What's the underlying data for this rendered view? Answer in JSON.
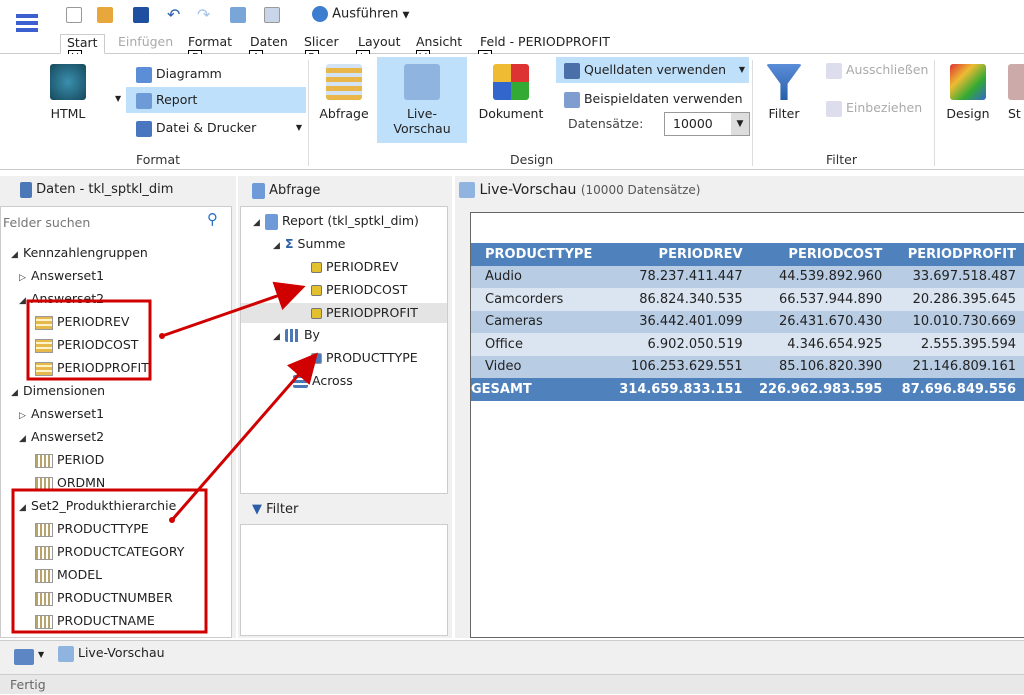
{
  "toolbar": {
    "run_label": "Ausführen"
  },
  "tabs": [
    {
      "label": "Start",
      "key": "H"
    },
    {
      "label": "Einfügen",
      "key": ""
    },
    {
      "label": "Format",
      "key": "F"
    },
    {
      "label": "Daten",
      "key": "A"
    },
    {
      "label": "Slicer",
      "key": "R"
    },
    {
      "label": "Layout",
      "key": "L"
    },
    {
      "label": "Ansicht",
      "key": "V"
    },
    {
      "label": "Feld - PERIODPROFIT",
      "key": "C"
    }
  ],
  "ribbon": {
    "format": {
      "group": "Format",
      "html": "HTML",
      "diagramm": "Diagramm",
      "report": "Report",
      "datei": "Datei & Drucker"
    },
    "design": {
      "group": "Design",
      "abfrage": "Abfrage",
      "live1": "Live-",
      "live2": "Vorschau",
      "dokument": "Dokument",
      "quelldaten": "Quelldaten verwenden",
      "beispiel": "Beispieldaten verwenden",
      "datensaetze_label": "Datensätze:",
      "datensaetze_value": "10000"
    },
    "filter": {
      "group": "Filter",
      "filter": "Filter",
      "ausschliessen": "Ausschließen",
      "einbeziehen": "Einbeziehen"
    },
    "other": {
      "design": "Design",
      "st": "St"
    }
  },
  "left": {
    "title": "Daten - tkl_sptkl_dim",
    "search_placeholder": "Felder suchen",
    "tree": [
      {
        "label": "Kennzahlengruppen",
        "lvl": 0,
        "tri": "◢"
      },
      {
        "label": "Answerset1",
        "lvl": 1,
        "tri": "▷"
      },
      {
        "label": "Answerset2",
        "lvl": 1,
        "tri": "◢"
      },
      {
        "label": "PERIODREV",
        "lvl": 2,
        "icon": "measure"
      },
      {
        "label": "PERIODCOST",
        "lvl": 2,
        "icon": "measure"
      },
      {
        "label": "PERIODPROFIT",
        "lvl": 2,
        "icon": "measure"
      },
      {
        "label": "Dimensionen",
        "lvl": 0,
        "tri": "◢"
      },
      {
        "label": "Answerset1",
        "lvl": 1,
        "tri": "▷"
      },
      {
        "label": "Answerset2",
        "lvl": 1,
        "tri": "◢"
      },
      {
        "label": "PERIOD",
        "lvl": 2,
        "icon": "dim"
      },
      {
        "label": "ORDMN",
        "lvl": 2,
        "icon": "dim"
      },
      {
        "label": "Set2_Produkthierarchie",
        "lvl": 1,
        "tri": "◢"
      },
      {
        "label": "PRODUCTTYPE",
        "lvl": 2,
        "icon": "dim"
      },
      {
        "label": "PRODUCTCATEGORY",
        "lvl": 2,
        "icon": "dim"
      },
      {
        "label": "MODEL",
        "lvl": 2,
        "icon": "dim"
      },
      {
        "label": "PRODUCTNUMBER",
        "lvl": 2,
        "icon": "dim"
      },
      {
        "label": "PRODUCTNAME",
        "lvl": 2,
        "icon": "dim"
      }
    ]
  },
  "middle": {
    "title": "Abfrage",
    "report": "Report (tkl_sptkl_dim)",
    "summe": "Summe",
    "sum_items": [
      "PERIODREV",
      "PERIODCOST",
      "PERIODPROFIT"
    ],
    "by": "By",
    "by_items": [
      "PRODUCTTYPE"
    ],
    "across": "Across",
    "filter_title": "Filter"
  },
  "preview": {
    "title": "Live-Vorschau",
    "count": "(10000 Datensätze)",
    "columns": [
      "PRODUCTTYPE",
      "PERIODREV",
      "PERIODCOST",
      "PERIODPROFIT"
    ],
    "rows": [
      [
        "Audio",
        "78.237.411.447",
        "44.539.892.960",
        "33.697.518.487"
      ],
      [
        "Camcorders",
        "86.824.340.535",
        "66.537.944.890",
        "20.286.395.645"
      ],
      [
        "Cameras",
        "36.442.401.099",
        "26.431.670.430",
        "10.010.730.669"
      ],
      [
        "Office",
        "6.902.050.519",
        "4.346.654.925",
        "2.555.395.594"
      ],
      [
        "Video",
        "106.253.629.551",
        "85.106.820.390",
        "21.146.809.161"
      ]
    ],
    "total": [
      "GESAMT",
      "314.659.833.151",
      "226.962.983.595",
      "87.696.849.556"
    ]
  },
  "bottom": {
    "tab": "Live-Vorschau"
  },
  "status": "Fertig",
  "colors": {
    "accent": "#4f81bd",
    "selection": "#bfe0fb",
    "annotation": "#d00000"
  }
}
